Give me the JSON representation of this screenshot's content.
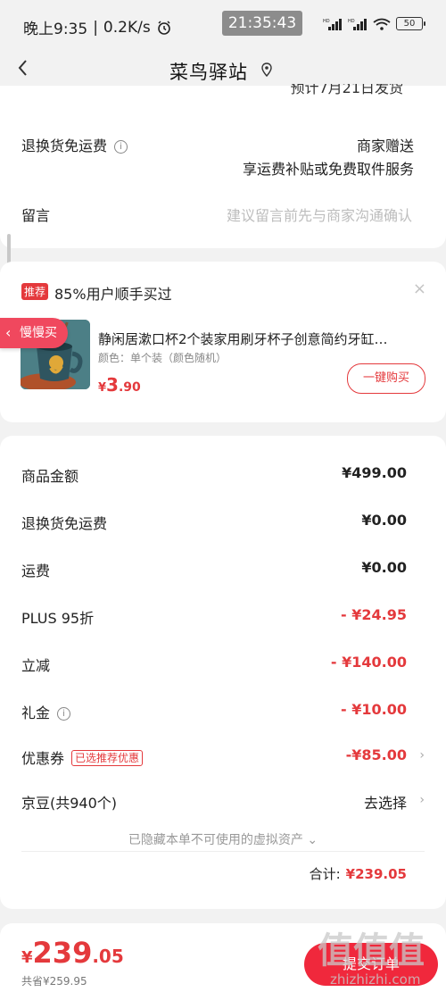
{
  "status_bar": {
    "time_text": "晚上9:35",
    "speed": "0.2K/s",
    "center_clock": "21:35:43",
    "battery": "50"
  },
  "nav": {
    "title": "菜鸟驿站"
  },
  "order_card": {
    "cut_text": "预计7月21日发货",
    "return_label": "退换货免运费",
    "return_value_line1": "商家赠送",
    "return_value_line2": "享运费补贴或免费取件服务",
    "message_label": "留言",
    "message_placeholder": "建议留言前先与商家沟通确认"
  },
  "recommend": {
    "badge": "推荐",
    "text": "85%用户顺手买过",
    "close": "×",
    "product_title": "静闲居漱口杯2个装家用刷牙杯子创意简约牙缸…",
    "product_spec": "颜色：单个装（颜色随机）",
    "price_currency": "¥",
    "price_int": "3",
    "price_dec": ".90",
    "buy_button": "一键购买"
  },
  "slow_pill": {
    "label": "慢慢买"
  },
  "amounts": {
    "rows": [
      {
        "label": "商品金额",
        "value": "¥499.00"
      },
      {
        "label": "退换货免运费",
        "value": "¥0.00"
      },
      {
        "label": "运费",
        "value": "¥0.00"
      },
      {
        "label": "PLUS 95折",
        "value": "- ¥24.95"
      },
      {
        "label": "立减",
        "value": "- ¥140.00"
      },
      {
        "label": "礼金",
        "value": "- ¥10.00"
      },
      {
        "label": "优惠券",
        "tag": "已选推荐优惠",
        "value": "-¥85.00"
      },
      {
        "label": "京豆(共940个)",
        "value": "去选择"
      }
    ],
    "hidden_note": "已隐藏本单不可使用的虚拟资产",
    "total_label": "合计:",
    "total_value": "¥239.05"
  },
  "bottom_bar": {
    "currency": "¥",
    "price_int": "239",
    "price_dec": ".05",
    "saved": "共省¥259.95",
    "submit": "提交订单"
  },
  "watermark": {
    "text": "值值值",
    "url": "zhizhizhi.com"
  },
  "colors": {
    "accent_red": "#e4393c",
    "submit_red": "#f0283c",
    "slow_pill": "#f0485e",
    "background": "#f2f2f2"
  }
}
